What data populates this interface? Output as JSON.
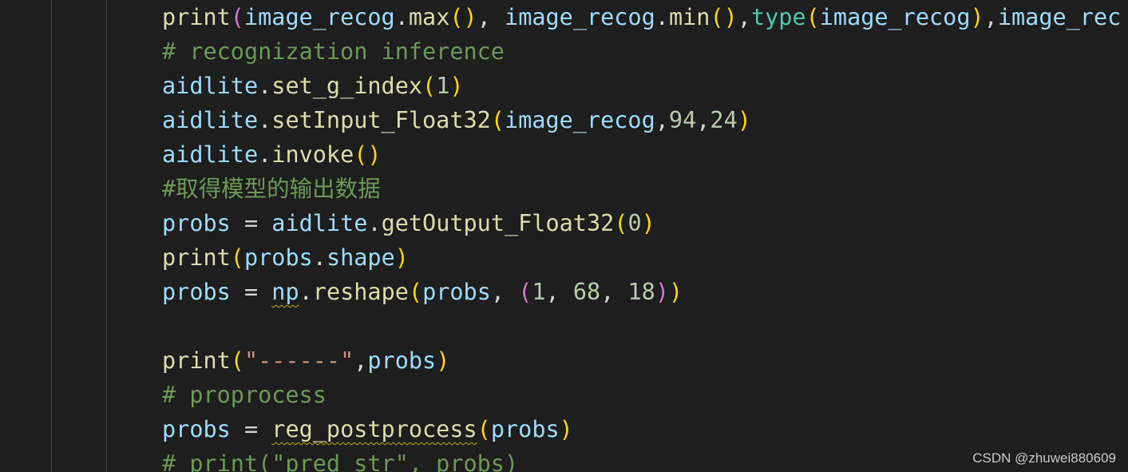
{
  "editor": {
    "lines": [
      [
        {
          "t": "print",
          "c": "fn"
        },
        {
          "t": "(",
          "c": "b2"
        },
        {
          "t": "image_recog",
          "c": "var"
        },
        {
          "t": ".",
          "c": "plain"
        },
        {
          "t": "max",
          "c": "fn"
        },
        {
          "t": "()",
          "c": "b1"
        },
        {
          "t": ", ",
          "c": "plain"
        },
        {
          "t": "image_recog",
          "c": "var"
        },
        {
          "t": ".",
          "c": "plain"
        },
        {
          "t": "min",
          "c": "fn"
        },
        {
          "t": "()",
          "c": "b1"
        },
        {
          "t": ",",
          "c": "plain"
        },
        {
          "t": "type",
          "c": "builtin"
        },
        {
          "t": "(",
          "c": "b1"
        },
        {
          "t": "image_recog",
          "c": "var"
        },
        {
          "t": ")",
          "c": "b1"
        },
        {
          "t": ",",
          "c": "plain"
        },
        {
          "t": "image_rec",
          "c": "var"
        }
      ],
      [
        {
          "t": "# recognization inference",
          "c": "comment"
        }
      ],
      [
        {
          "t": "aidlite",
          "c": "var"
        },
        {
          "t": ".",
          "c": "plain"
        },
        {
          "t": "set_g_index",
          "c": "fn"
        },
        {
          "t": "(",
          "c": "b1"
        },
        {
          "t": "1",
          "c": "num"
        },
        {
          "t": ")",
          "c": "b1"
        }
      ],
      [
        {
          "t": "aidlite",
          "c": "var"
        },
        {
          "t": ".",
          "c": "plain"
        },
        {
          "t": "setInput_Float32",
          "c": "fn"
        },
        {
          "t": "(",
          "c": "b1"
        },
        {
          "t": "image_recog",
          "c": "var"
        },
        {
          "t": ",",
          "c": "plain"
        },
        {
          "t": "94",
          "c": "num"
        },
        {
          "t": ",",
          "c": "plain"
        },
        {
          "t": "24",
          "c": "num"
        },
        {
          "t": ")",
          "c": "b1"
        }
      ],
      [
        {
          "t": "aidlite",
          "c": "var"
        },
        {
          "t": ".",
          "c": "plain"
        },
        {
          "t": "invoke",
          "c": "fn"
        },
        {
          "t": "()",
          "c": "b1"
        }
      ],
      [
        {
          "t": "#取得模型的输出数据",
          "c": "comment"
        }
      ],
      [
        {
          "t": "probs",
          "c": "var"
        },
        {
          "t": " = ",
          "c": "plain"
        },
        {
          "t": "aidlite",
          "c": "var"
        },
        {
          "t": ".",
          "c": "plain"
        },
        {
          "t": "getOutput_Float32",
          "c": "fn"
        },
        {
          "t": "(",
          "c": "b1"
        },
        {
          "t": "0",
          "c": "num"
        },
        {
          "t": ")",
          "c": "b1"
        }
      ],
      [
        {
          "t": "print",
          "c": "fn"
        },
        {
          "t": "(",
          "c": "b1"
        },
        {
          "t": "probs",
          "c": "var"
        },
        {
          "t": ".",
          "c": "plain"
        },
        {
          "t": "shape",
          "c": "var"
        },
        {
          "t": ")",
          "c": "b1"
        }
      ],
      [
        {
          "t": "probs",
          "c": "var"
        },
        {
          "t": " = ",
          "c": "plain"
        },
        {
          "t": "np",
          "c": "var squiggle"
        },
        {
          "t": ".",
          "c": "plain"
        },
        {
          "t": "reshape",
          "c": "fn"
        },
        {
          "t": "(",
          "c": "b1"
        },
        {
          "t": "probs",
          "c": "var"
        },
        {
          "t": ", ",
          "c": "plain"
        },
        {
          "t": "(",
          "c": "b2"
        },
        {
          "t": "1",
          "c": "num"
        },
        {
          "t": ", ",
          "c": "plain"
        },
        {
          "t": "68",
          "c": "num"
        },
        {
          "t": ", ",
          "c": "plain"
        },
        {
          "t": "18",
          "c": "num"
        },
        {
          "t": ")",
          "c": "b2"
        },
        {
          "t": ")",
          "c": "b1"
        }
      ],
      [],
      [
        {
          "t": "print",
          "c": "fn"
        },
        {
          "t": "(",
          "c": "b1"
        },
        {
          "t": "\"------\"",
          "c": "str"
        },
        {
          "t": ",",
          "c": "plain"
        },
        {
          "t": "probs",
          "c": "var"
        },
        {
          "t": ")",
          "c": "b1"
        }
      ],
      [
        {
          "t": "# proprocess",
          "c": "comment"
        }
      ],
      [
        {
          "t": "probs",
          "c": "var"
        },
        {
          "t": " = ",
          "c": "plain"
        },
        {
          "t": "reg_postprocess",
          "c": "fn squiggle"
        },
        {
          "t": "(",
          "c": "b1"
        },
        {
          "t": "probs",
          "c": "var"
        },
        {
          "t": ")",
          "c": "b1"
        }
      ],
      [
        {
          "t": "# print(\"pred_str\", probs)",
          "c": "comment"
        }
      ]
    ]
  },
  "watermark": {
    "text": "CSDN @zhuwei880609"
  }
}
